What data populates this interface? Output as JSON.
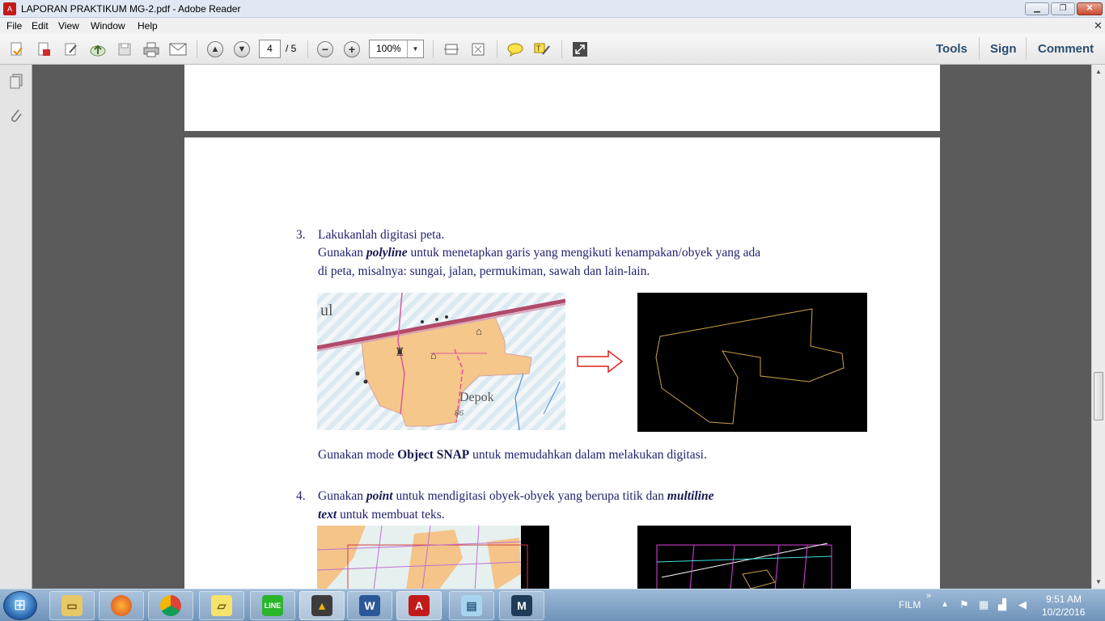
{
  "window": {
    "title": "LAPORAN PRAKTIKUM MG-2.pdf - Adobe Reader"
  },
  "menu": [
    "File",
    "Edit",
    "View",
    "Window",
    "Help"
  ],
  "toolbar": {
    "page_current": "4",
    "page_total": "/ 5",
    "zoom": "100%",
    "tools_label": "Tools",
    "sign_label": "Sign",
    "comment_label": "Comment"
  },
  "document": {
    "item3": {
      "number": "3.",
      "line1": "Lakukanlah digitasi peta.",
      "line2_pre": "Gunakan ",
      "line2_em": "polyline",
      "line2_post": " untuk menetapkan garis yang mengikuti kenampakan/obyek yang ada",
      "line3": "di peta, misalnya: sungai, jalan, permukiman, sawah dan lain-lain.",
      "map_label_town": "Depok",
      "map_label_number": "86",
      "map_label_corner": "ul",
      "snap_pre": "Gunakan mode ",
      "snap_bold": "Object SNAP",
      "snap_post": " untuk memudahkan dalam melakukan digitasi."
    },
    "item4": {
      "number": "4.",
      "line1_pre": "Gunakan ",
      "line1_em1": "point",
      "line1_mid": " untuk mendigitasi obyek-obyek yang berupa titik dan ",
      "line1_em2": "multiline",
      "line2_em": "text",
      "line2_post": " untuk membuat teks."
    }
  },
  "taskbar": {
    "apps": [
      "explorer",
      "firefox",
      "chrome",
      "sticky-notes",
      "line",
      "autocad-map",
      "word",
      "adobe-reader",
      "notepad",
      "autocad"
    ],
    "tray_label": "FILM",
    "time": "9:51 AM",
    "date": "10/2/2016"
  },
  "colors": {
    "doc_text": "#1f1f6e",
    "toolbar_accent": "#2b4e72",
    "polyline_stroke": "#c9a24a",
    "arrow_stroke": "#e02020"
  }
}
